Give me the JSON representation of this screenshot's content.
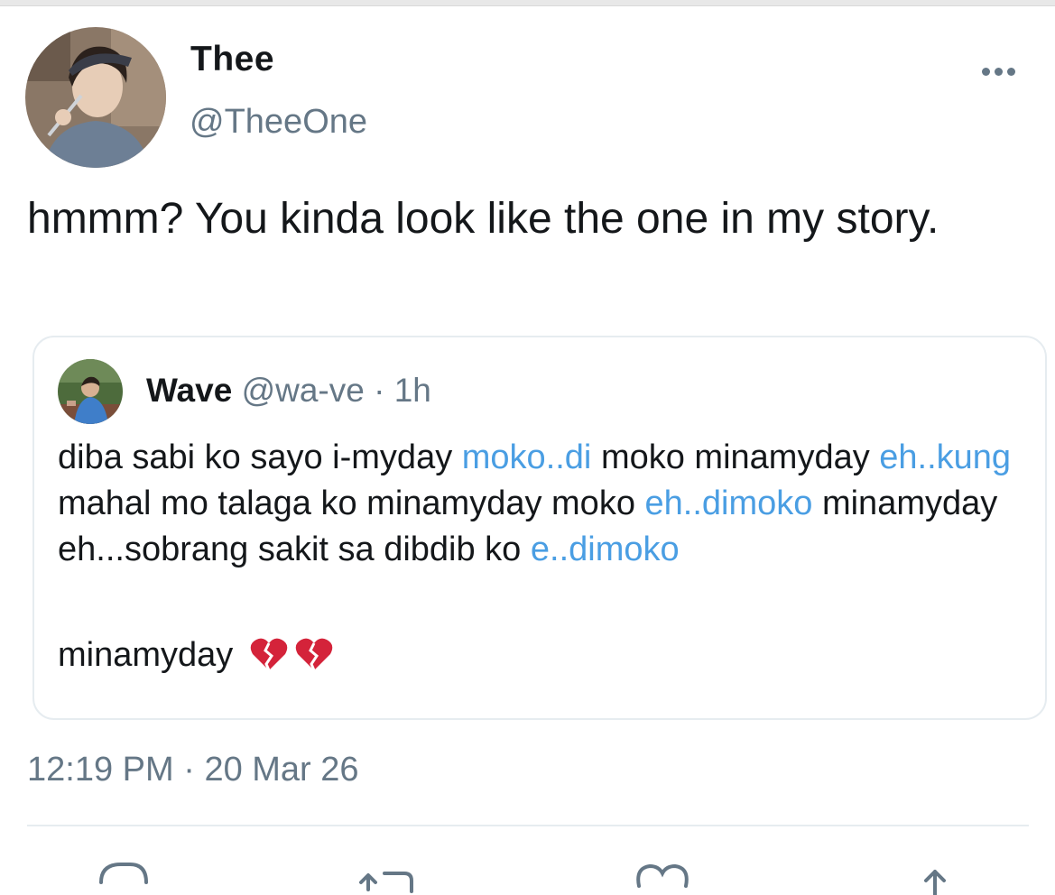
{
  "author": {
    "name": "Thee",
    "handle": "@TheeOne"
  },
  "tweet": {
    "text": "hmmm? You kinda look like the one in my story."
  },
  "quoted_tweet": {
    "name": "Wave",
    "handle": "@wa-ve",
    "separator": " · ",
    "age": "1h",
    "body_segments": [
      {
        "text": "diba sabi ko sayo i-myday ",
        "link": false
      },
      {
        "text": "moko..di",
        "link": true
      },
      {
        "text": " moko minamyday ",
        "link": false
      },
      {
        "text": "eh..kung",
        "link": true
      },
      {
        "text": " mahal mo talaga ko minamyday moko ",
        "link": false
      },
      {
        "text": "eh..dimoko",
        "link": true
      },
      {
        "text": " minamyday eh...sobrang sakit sa dibdib ko ",
        "link": false
      },
      {
        "text": "e..dimoko",
        "link": true
      }
    ],
    "last_line": "minamyday",
    "emoji": [
      "broken-heart-icon",
      "broken-heart-icon"
    ]
  },
  "meta": {
    "time": "12:19 PM",
    "separator": " · ",
    "date": "20 Mar 26"
  },
  "actions": [
    "reply-icon",
    "retweet-icon",
    "like-icon",
    "share-icon"
  ],
  "colors": {
    "text": "#14171a",
    "secondary": "#657786",
    "link": "#4a9ee3",
    "border": "#e6ecf0",
    "heart": "#d4233a"
  }
}
